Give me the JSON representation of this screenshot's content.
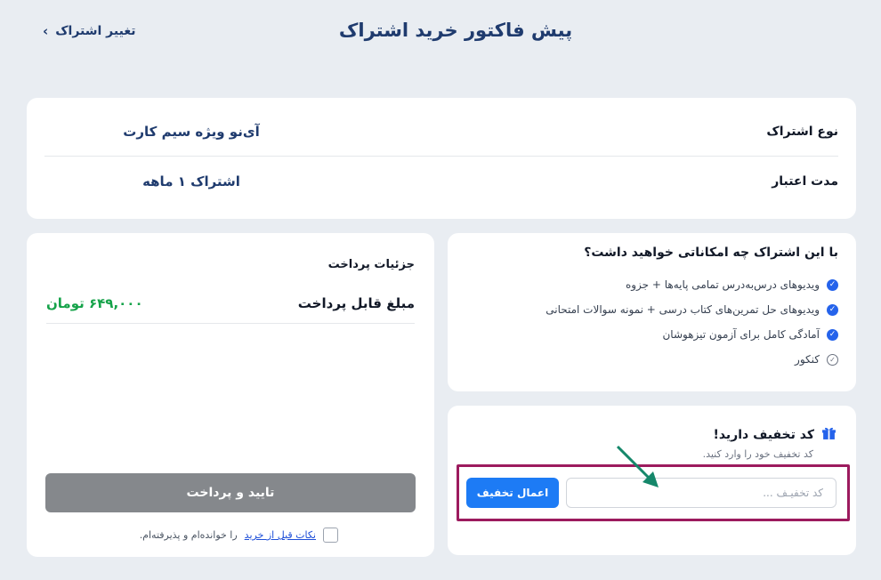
{
  "header": {
    "title": "پیش فاکتور خرید اشتراک",
    "back_label": "تغییر اشتراک"
  },
  "subscription": {
    "type_label": "نوع اشتراک",
    "type_value": "آی‌نو ویژه سیم کارت",
    "duration_label": "مدت اعتبار",
    "duration_value": "اشتراک ۱ ماهه"
  },
  "features": {
    "title": "با این اشتراک چه امکاناتی خواهید داشت؟",
    "items": [
      {
        "label": "ویدیوهای درس‌به‌درس تمامی پایه‌ها + جزوه",
        "icon": "check-circle-filled"
      },
      {
        "label": "ویدیوهای حل تمرین‌های کتاب درسی + نمونه سوالات امتحانی",
        "icon": "check-circle-filled"
      },
      {
        "label": "آمادگی کامل برای آزمون تیزهوشان",
        "icon": "check-circle-filled"
      },
      {
        "label": "کنکور",
        "icon": "check-circle-outline"
      }
    ]
  },
  "discount": {
    "title": "کد تخفیف دارید!",
    "subtitle": "کد تخفیف خود را وارد کنید.",
    "placeholder": "کد تخفیـف ...",
    "apply_label": "اعمال تخفیف",
    "icon": "gift-icon",
    "highlight_color": "#9c1b5e"
  },
  "payment": {
    "title": "جزئیات پرداخت",
    "amount_label": "مبلغ قابل پرداخت",
    "amount_value": "۶۴۹,۰۰۰ تومان",
    "button_label": "تایید و پرداخت",
    "terms_link": "نکات قبل از خرید",
    "terms_text": "را خوانده‌ام و پذیرفته‌ام."
  },
  "colors": {
    "primary": "#1d7bf5",
    "title": "#1f3b6e",
    "amount": "#16a34a",
    "disabled_button": "#85888c"
  }
}
